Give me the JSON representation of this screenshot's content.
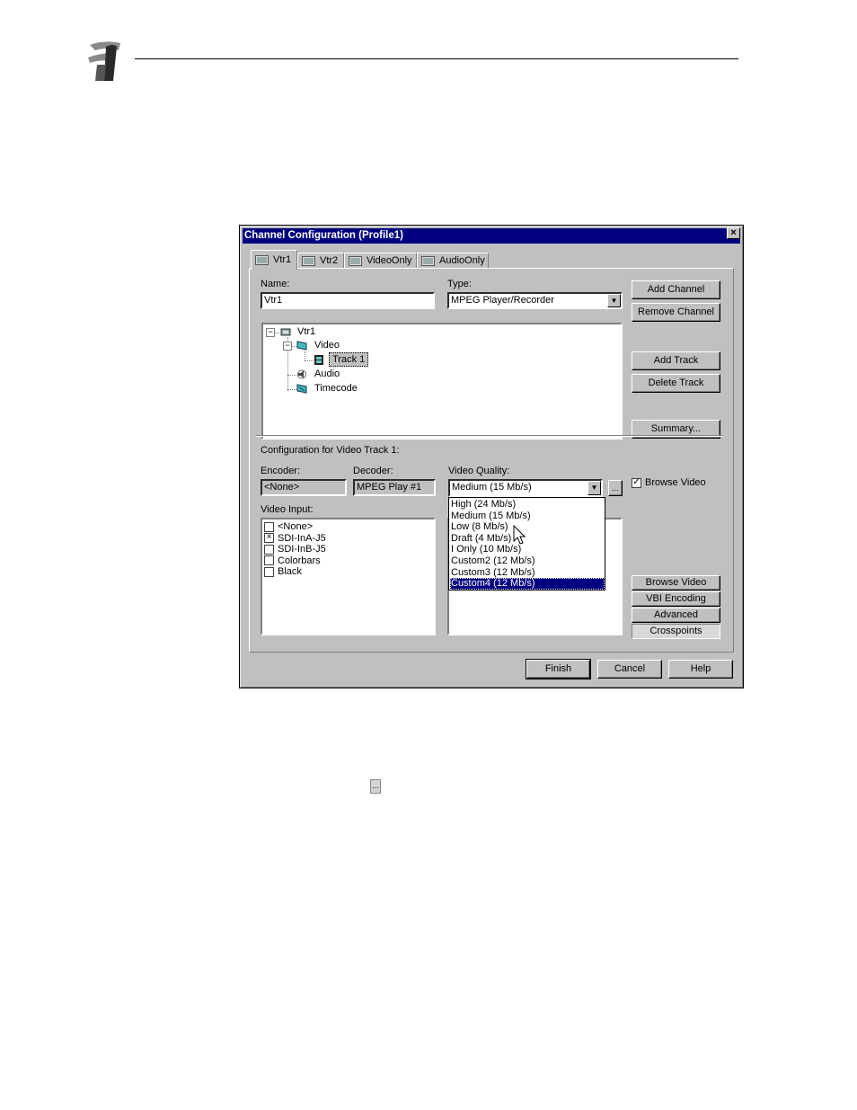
{
  "dialog": {
    "title": "Channel Configuration (Profile1)",
    "close_label": "×",
    "tabs": [
      {
        "label": "Vtr1",
        "active": true
      },
      {
        "label": "Vtr2",
        "active": false
      },
      {
        "label": "VideoOnly",
        "active": false
      },
      {
        "label": "AudioOnly",
        "active": false
      }
    ],
    "name_label": "Name:",
    "name_value": "Vtr1",
    "type_label": "Type:",
    "type_value": "MPEG Player/Recorder",
    "tree": {
      "root": "Vtr1",
      "video": "Video",
      "track": "Track 1",
      "audio": "Audio",
      "timecode": "Timecode"
    },
    "buttons": {
      "add_channel": "Add Channel",
      "remove_channel": "Remove Channel",
      "add_track": "Add Track",
      "delete_track": "Delete Track",
      "summary": "Summary...",
      "browse_video": "Browse Video",
      "vbi_encoding": "VBI Encoding",
      "advanced": "Advanced",
      "crosspoints": "Crosspoints",
      "finish": "Finish",
      "cancel": "Cancel",
      "help": "Help"
    },
    "config_heading": "Configuration for Video Track 1:",
    "encoder_label": "Encoder:",
    "encoder_value": "<None>",
    "decoder_label": "Decoder:",
    "decoder_value": "MPEG Play #1",
    "quality_label": "Video Quality:",
    "quality_value": "Medium (15 Mb/s)",
    "quality_more": "...",
    "quality_options": [
      "High (24 Mb/s)",
      "Medium (15 Mb/s)",
      "Low (8 Mb/s)",
      "Draft (4 Mb/s)",
      "I Only (10 Mb/s)",
      "Custom2 (12 Mb/s)",
      "Custom3 (12 Mb/s)",
      "Custom4 (12 Mb/s)"
    ],
    "quality_highlighted_index": 7,
    "browse_video_checkbox_label": "Browse Video",
    "browse_video_checked": true,
    "video_input_label": "Video Input:",
    "video_inputs": [
      {
        "label": "<None>",
        "checked": false
      },
      {
        "label": "SDI-InA-J5",
        "checked": true
      },
      {
        "label": "SDI-InB-J5",
        "checked": false
      },
      {
        "label": "Colorbars",
        "checked": false
      },
      {
        "label": "Black",
        "checked": false
      }
    ]
  },
  "page": {
    "inline_button_label": "..."
  }
}
